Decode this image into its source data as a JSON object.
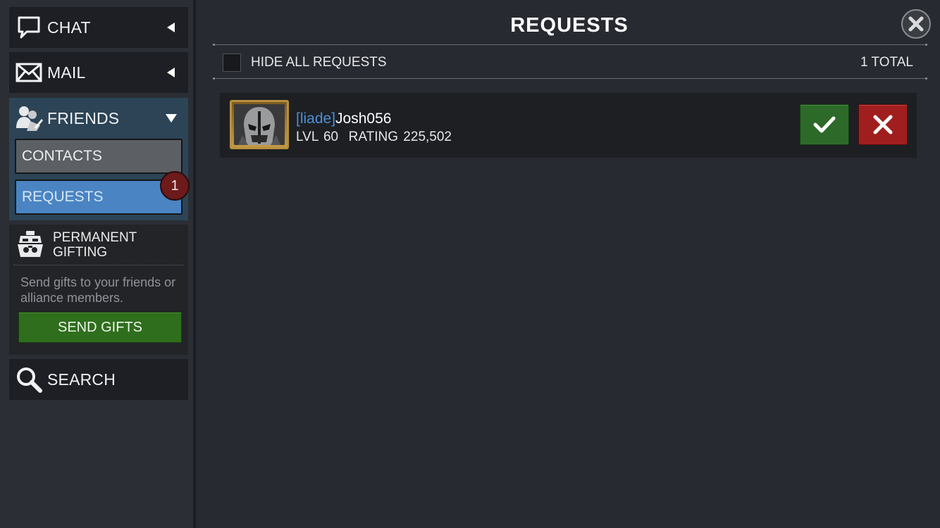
{
  "sidebar": {
    "chat": {
      "label": "CHAT",
      "icon": "speech-bubble-icon"
    },
    "mail": {
      "label": "MAIL",
      "icon": "envelope-icon"
    },
    "friends": {
      "label": "FRIENDS",
      "icon": "friends-icon",
      "contacts_label": "CONTACTS",
      "requests_label": "REQUESTS",
      "requests_badge": "1"
    },
    "gifting": {
      "title_line1": "PERMANENT",
      "title_line2": "GIFTING",
      "description": "Send gifts to your friends or alliance members.",
      "button_label": "SEND GIFTS",
      "icon": "gift-mascot-icon"
    },
    "search": {
      "label": "SEARCH",
      "icon": "magnifier-icon"
    }
  },
  "main": {
    "title": "REQUESTS",
    "hide_all_label": "HIDE ALL REQUESTS",
    "hide_all_checked": false,
    "total_label": "1 TOTAL",
    "requests": [
      {
        "alliance_tag": "[liade]",
        "name": "Josh056",
        "stats": "LVL 60  RATING 225,502"
      }
    ]
  },
  "colors": {
    "accent_blue": "#4a84c3",
    "accept_green": "#2d6a29",
    "decline_red": "#a11e1e",
    "badge_red": "#6d1a1a",
    "frame_gold": "#b8903e"
  }
}
